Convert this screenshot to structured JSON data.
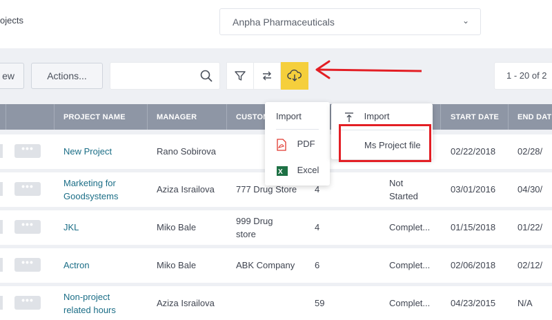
{
  "header": {
    "breadcrumb": "ojects",
    "company_select": "Anpha Pharmaceuticals"
  },
  "toolbar": {
    "new_label": "ew",
    "actions_label": "Actions...",
    "search_value": "",
    "pagination": "1 - 20 of 2"
  },
  "icons": {
    "search": "search-icon",
    "filter": "filter-icon",
    "swap": "swap-arrows-icon",
    "download": "cloud-download-icon",
    "chevron": "chevron-down-icon",
    "pdf": "pdf-file-icon",
    "excel": "excel-file-icon",
    "upload": "upload-icon",
    "annotation_arrow": "red-arrow-icon"
  },
  "colors": {
    "accent": "#f5cf3c",
    "header_bg": "#8e96a5",
    "link": "#1a6d86",
    "annotation": "#e31e24"
  },
  "table": {
    "headers": {
      "project_name": "PROJECT NAME",
      "manager": "MANAGER",
      "customer": "CUSTOM",
      "start_date": "START DATE",
      "end_date": "END DAT"
    },
    "rows": [
      {
        "name": "New Project",
        "manager": "Rano Sobirova",
        "customer": "",
        "count": "",
        "status": "",
        "start": "02/22/2018",
        "end": "02/28/"
      },
      {
        "name": "Marketing for Goodsystems",
        "manager": "Aziza Israilova",
        "customer": "777 Drug Store",
        "count": "4",
        "status": "Not Started",
        "start": "03/01/2016",
        "end": "04/30/"
      },
      {
        "name": "JKL",
        "manager": "Miko Bale",
        "customer": "999 Drug store",
        "count": "4",
        "status": "Complet...",
        "start": "01/15/2018",
        "end": "01/22/"
      },
      {
        "name": "Actron",
        "manager": "Miko Bale",
        "customer": "ABK Company",
        "count": "6",
        "status": "Complet...",
        "start": "02/06/2018",
        "end": "02/12/"
      },
      {
        "name": "Non-project related hours",
        "manager": "Aziza Israilova",
        "customer": "",
        "count": "59",
        "status": "Complet...",
        "start": "04/23/2015",
        "end": "N/A"
      }
    ]
  },
  "export_menu": {
    "import": "Import",
    "pdf": "PDF",
    "excel": "Excel"
  },
  "import_menu": {
    "import": "Import",
    "ms_project": "Ms Project file"
  }
}
